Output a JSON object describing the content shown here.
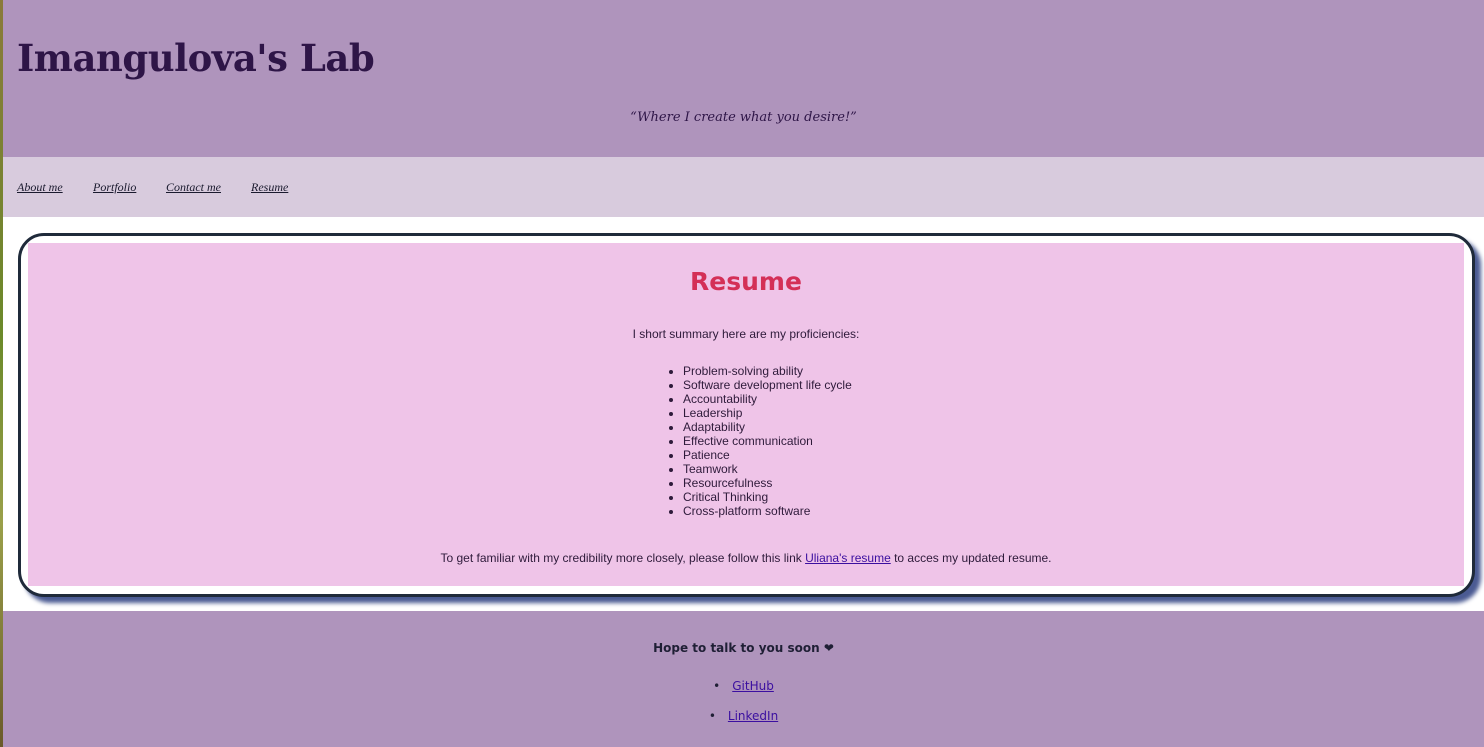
{
  "header": {
    "title": "Imangulova's Lab",
    "tagline": "“Where I create what you desire!”"
  },
  "nav": {
    "items": [
      {
        "label": "About me"
      },
      {
        "label": "Portfolio"
      },
      {
        "label": "Contact me"
      },
      {
        "label": "Resume"
      }
    ]
  },
  "resume": {
    "title": "Resume",
    "summary": "I short summary here are my proficiencies:",
    "skills": [
      "Problem-solving ability",
      "Software development life cycle",
      "Accountability",
      "Leadership",
      "Adaptability",
      "Effective communication",
      "Patience",
      "Teamwork",
      "Resourcefulness",
      "Critical Thinking",
      "Cross-platform software"
    ],
    "credibility_before": "To get familiar with my credibility more closely, please follow this link ",
    "credibility_link": "Uliana's resume",
    "credibility_after": " to acces my updated resume."
  },
  "footer": {
    "message": "Hope to talk to you soon ❤",
    "links": [
      {
        "label": "GitHub"
      },
      {
        "label": "LinkedIn"
      }
    ]
  },
  "colors": {
    "header_bg": "#af94bc",
    "nav_bg": "#d8cbdd",
    "card_bg": "#efc4e8",
    "title_accent": "#d42f57",
    "link": "#3b0fa0"
  }
}
